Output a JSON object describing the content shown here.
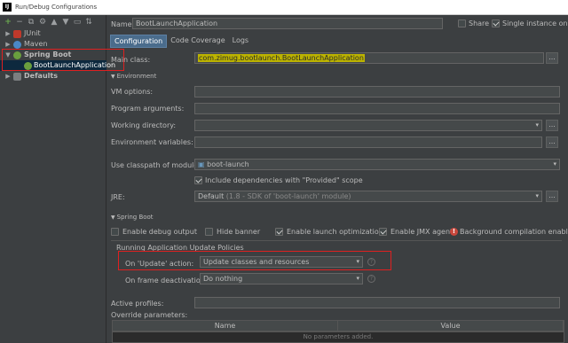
{
  "window": {
    "title": "Run/Debug Configurations",
    "app_icon": "IJ"
  },
  "left": {
    "toolbar_icons": [
      "add-icon",
      "remove-icon",
      "copy-icon",
      "settings-icon",
      "move-up-icon",
      "move-down-icon",
      "folder-icon",
      "sort-icon"
    ],
    "tree": {
      "junit": "JUnit",
      "maven": "Maven",
      "spring_boot": "Spring Boot",
      "boot_app": "BootLaunchApplication",
      "defaults": "Defaults"
    }
  },
  "header": {
    "name_label": "Name:",
    "name_value": "BootLaunchApplication",
    "share_label": "Share",
    "single_instance_label": "Single instance only"
  },
  "tabs": [
    "Configuration",
    "Code Coverage",
    "Logs"
  ],
  "config": {
    "main_class_label": "Main class:",
    "main_class_value": "com.zimug.bootlaunch.BootLaunchApplication",
    "environment_section": "Environment",
    "vm_options_label": "VM options:",
    "program_args_label": "Program arguments:",
    "working_dir_label": "Working directory:",
    "env_vars_label": "Environment variables:",
    "classpath_label": "Use classpath of module:",
    "classpath_value": "boot-launch",
    "include_provided_label": "Include dependencies with \"Provided\" scope",
    "jre_label": "JRE:",
    "jre_value": "Default",
    "jre_hint": "(1.8 - SDK of 'boot-launch' module)",
    "ellipsis": "..."
  },
  "spring": {
    "section": "Spring Boot",
    "debug_output": "Enable debug output",
    "hide_banner": "Hide banner",
    "launch_opt": "Enable launch optimization",
    "jmx_agent": "Enable JMX agent",
    "bg_compile": "Background compilation enabled",
    "policies_title": "Running Application Update Policies",
    "on_update_label": "On 'Update' action:",
    "on_update_value": "Update classes and resources",
    "on_frame_label": "On frame deactivation:",
    "on_frame_value": "Do nothing",
    "active_profiles_label": "Active profiles:",
    "override_params_label": "Override parameters:",
    "table_headers": [
      "Name",
      "Value"
    ],
    "table_empty": "No parameters added."
  }
}
